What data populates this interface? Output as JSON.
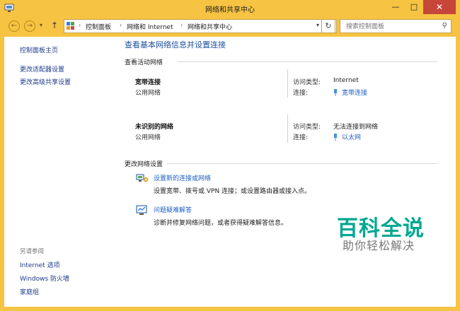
{
  "window": {
    "title": "网络和共享中心",
    "minimize_glyph": "—",
    "maximize_glyph": "□",
    "close_glyph": "✕"
  },
  "address_bar": {
    "breadcrumbs": [
      "控制面板",
      "网络和 Internet",
      "网络和共享中心"
    ],
    "search_placeholder": "搜索控制面板"
  },
  "sidebar": {
    "links": [
      "控制面板主页",
      "更改适配器设置",
      "更改高级共享设置"
    ],
    "see_also_heading": "另请参阅",
    "see_also_links": [
      "Internet 选项",
      "Windows 防火墙",
      "家庭组"
    ]
  },
  "main": {
    "title": "查看基本网络信息并设置连接",
    "active_networks_heading": "查看活动网络",
    "networks": [
      {
        "name": "宽带连接",
        "category": "公用网络",
        "access_label": "访问类型:",
        "access_value": "Internet",
        "conn_label": "连接:",
        "conn_value": "宽带连接"
      },
      {
        "name": "未识别的网络",
        "category": "公用网络",
        "access_label": "访问类型:",
        "access_value": "无法连接到网络",
        "conn_label": "连接:",
        "conn_value": "以太网"
      }
    ],
    "change_settings_heading": "更改网络设置",
    "tasks": [
      {
        "link": "设置新的连接或网络",
        "desc": "设置宽带、拨号或 VPN 连接；或设置路由器或接入点。"
      },
      {
        "link": "问题疑难解答",
        "desc": "诊断并修复网络问题，或者获得疑难解答信息。"
      }
    ]
  },
  "watermark": {
    "title": "百科全说",
    "subtitle": "助你轻松解决"
  },
  "colors": {
    "frame": "#f6c342",
    "link": "#1e5fc0",
    "title": "#1e4fa0",
    "close": "#c7463a",
    "watermark": "#00a88f"
  }
}
